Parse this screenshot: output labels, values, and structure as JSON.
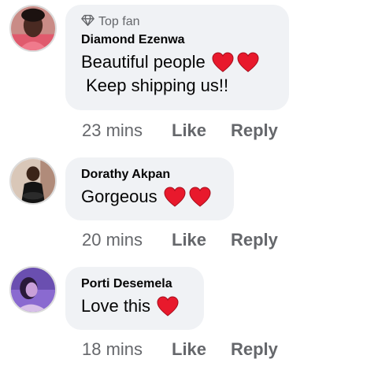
{
  "comments": [
    {
      "badge": "Top fan",
      "name": "Diamond Ezenwa",
      "lines": [
        "Beautiful people",
        " Keep shipping us!!"
      ],
      "hearts_line1": 2,
      "time": "23 mins",
      "like_label": "Like",
      "reply_label": "Reply"
    },
    {
      "name": "Dorathy Akpan",
      "lines": [
        "Gorgeous"
      ],
      "hearts_line1": 2,
      "time": "20 mins",
      "like_label": "Like",
      "reply_label": "Reply"
    },
    {
      "name": "Porti Desemela",
      "lines": [
        "Love this"
      ],
      "hearts_line1": 1,
      "time": "18 mins",
      "like_label": "Like",
      "reply_label": "Reply"
    }
  ],
  "colors": {
    "bubble_bg": "#f0f2f5",
    "meta_text": "#65676b",
    "heart": "#e8192c"
  },
  "icons": {
    "badge_icon": "diamond-icon",
    "reaction_icon": "red-heart-icon"
  }
}
